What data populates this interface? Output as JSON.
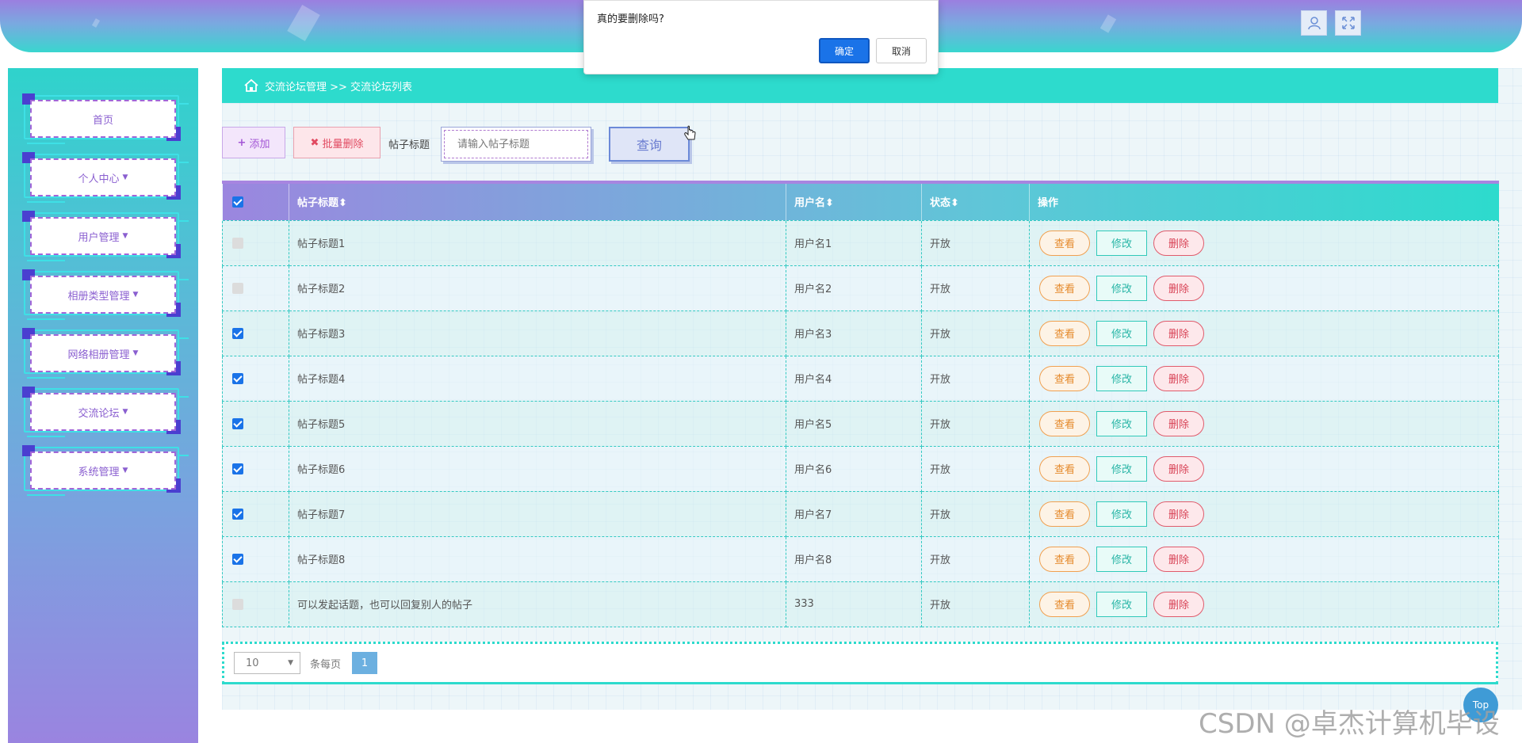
{
  "header": {
    "icons": [
      "user-icon",
      "fullscreen-icon"
    ]
  },
  "sidebar": {
    "items": [
      {
        "label": "首页",
        "has_caret": false
      },
      {
        "label": "个人中心",
        "has_caret": true
      },
      {
        "label": "用户管理",
        "has_caret": true
      },
      {
        "label": "相册类型管理",
        "has_caret": true
      },
      {
        "label": "网络相册管理",
        "has_caret": true
      },
      {
        "label": "交流论坛",
        "has_caret": true
      },
      {
        "label": "系统管理",
        "has_caret": true
      }
    ]
  },
  "breadcrumb": {
    "text": "交流论坛管理 >> 交流论坛列表"
  },
  "toolbar": {
    "add_label": "添加",
    "batch_delete_label": "批量删除",
    "search_label": "帖子标题",
    "search_placeholder": "请输入帖子标题",
    "query_label": "查询"
  },
  "table": {
    "columns": [
      "帖子标题",
      "用户名",
      "状态",
      "操作"
    ],
    "sortable": [
      "帖子标题",
      "用户名",
      "状态"
    ],
    "header_checked": true,
    "rows": [
      {
        "checked": false,
        "title": "帖子标题1",
        "user": "用户名1",
        "status": "开放"
      },
      {
        "checked": false,
        "title": "帖子标题2",
        "user": "用户名2",
        "status": "开放"
      },
      {
        "checked": true,
        "title": "帖子标题3",
        "user": "用户名3",
        "status": "开放"
      },
      {
        "checked": true,
        "title": "帖子标题4",
        "user": "用户名4",
        "status": "开放"
      },
      {
        "checked": true,
        "title": "帖子标题5",
        "user": "用户名5",
        "status": "开放"
      },
      {
        "checked": true,
        "title": "帖子标题6",
        "user": "用户名6",
        "status": "开放"
      },
      {
        "checked": true,
        "title": "帖子标题7",
        "user": "用户名7",
        "status": "开放"
      },
      {
        "checked": true,
        "title": "帖子标题8",
        "user": "用户名8",
        "status": "开放"
      },
      {
        "checked": false,
        "title": "可以发起话题，也可以回复别人的帖子",
        "user": "333",
        "status": "开放"
      }
    ],
    "actions": {
      "view": "查看",
      "edit": "修改",
      "delete": "删除"
    }
  },
  "pagination": {
    "page_size": "10",
    "page_size_label": "条每页",
    "current_page": "1"
  },
  "dialog": {
    "message": "真的要删除吗?",
    "ok_label": "确定",
    "cancel_label": "取消"
  },
  "top_button_label": "Top",
  "watermark": "CSDN @卓杰计算机毕设",
  "colors": {
    "accent_teal": "#2ddbcd",
    "accent_purple": "#9b7fe0",
    "primary_blue": "#1a73e8"
  }
}
